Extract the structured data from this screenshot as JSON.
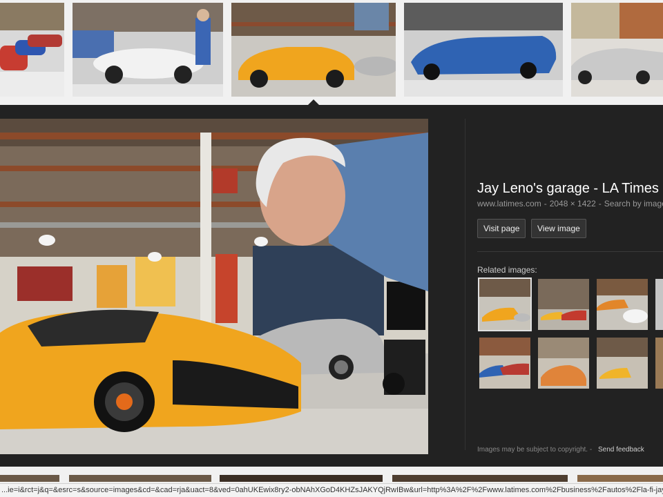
{
  "top_thumbnails": [
    {
      "name": "red cars row",
      "color": "#c9564a"
    },
    {
      "name": "white jaguar with man",
      "color": "#e3e3e3"
    },
    {
      "name": "yellow mclaren",
      "color": "#e3a21e"
    },
    {
      "name": "blue race car",
      "color": "#2f63b3"
    },
    {
      "name": "silver porsche",
      "color": "#c9c9c9"
    }
  ],
  "preview": {
    "title": "Jay Leno's garage - LA Times",
    "domain": "www.latimes.com",
    "dimensions": "2048 × 1422",
    "search_link": "Search by image",
    "separator": "-",
    "visit_button": "Visit page",
    "view_button": "View image"
  },
  "related": {
    "label": "Related images:",
    "items": [
      {
        "color": "#d79a2a",
        "selected": true
      },
      {
        "color": "#b48a4a",
        "selected": false
      },
      {
        "color": "#cf7a2e",
        "selected": false
      },
      {
        "color": "#c5c5c5",
        "selected": false
      },
      {
        "color": "#a8443e",
        "selected": false
      },
      {
        "color": "#d28a4a",
        "selected": false
      },
      {
        "color": "#bd8d3e",
        "selected": false
      },
      {
        "color": "#9a7a56",
        "selected": false
      }
    ]
  },
  "footer": {
    "copyright": "Images may be subject to copyright.",
    "separator": "-",
    "feedback": "Send feedback"
  },
  "status_url": "...ie=i&rct=j&q=&esrc=s&source=images&cd=&cad=rja&uact=8&ved=0ahUKEwix8ry2-obNAhXGoD4KHZsJAKYQjRwIBw&url=http%3A%2F%2Fwww.latimes.com%2Fbusiness%2Fautos%2Fla-fi-jay",
  "colors": {
    "panel_bg": "#222222",
    "accent_yellow": "#f0a51e"
  }
}
